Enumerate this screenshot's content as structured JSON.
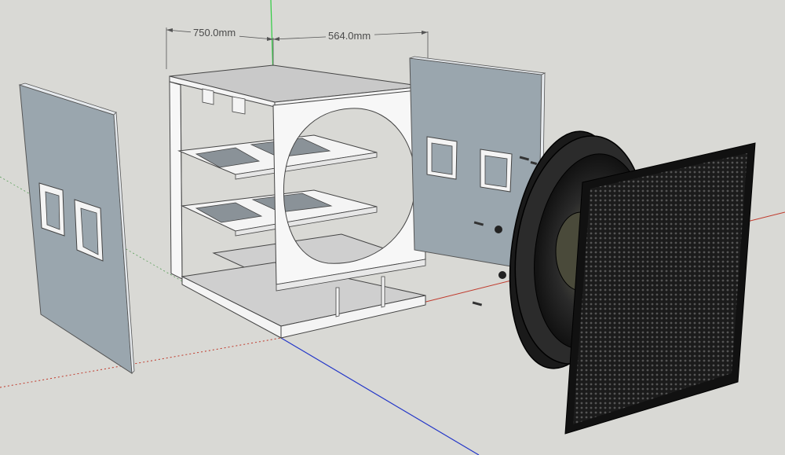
{
  "dimensions": {
    "width_label": "750.0mm",
    "depth_label": "564.0mm"
  },
  "colors": {
    "background": "#d9d9d5",
    "panel_blue": "#9aa6ae",
    "panel_edge": "#e6eaee",
    "white_board": "#f4f4f4",
    "board_shade": "#cfcfcf",
    "grille": "#1c1c1c",
    "axis_red": "#c0392b",
    "axis_green": "#2ecc40",
    "axis_blue": "#2437c8"
  },
  "icons": [
    "speaker-driver-icon",
    "grille-mesh-icon",
    "screw-icon"
  ]
}
